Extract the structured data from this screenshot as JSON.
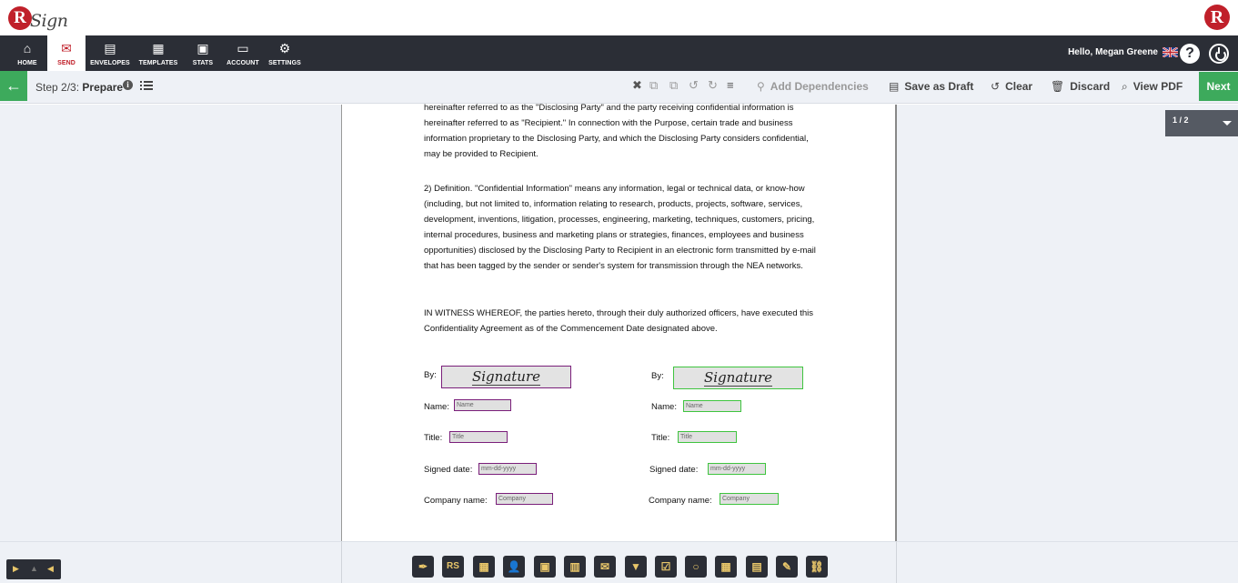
{
  "brand": {
    "logo_letter": "R",
    "logo_text": "Sign",
    "logo_right_letter": "R"
  },
  "nav": {
    "items": [
      {
        "label": "HOME",
        "icon": "home-icon",
        "glyph": "⌂"
      },
      {
        "label": "SEND",
        "icon": "envelope-icon",
        "glyph": "✉"
      },
      {
        "label": "ENVELOPES",
        "icon": "inbox-icon",
        "glyph": "▤"
      },
      {
        "label": "TEMPLATES",
        "icon": "template-icon",
        "glyph": "▦"
      },
      {
        "label": "STATS",
        "icon": "briefcase-icon",
        "glyph": "▣"
      },
      {
        "label": "ACCOUNT",
        "icon": "account-icon",
        "glyph": "▭"
      },
      {
        "label": "SETTINGS",
        "icon": "gear-icon",
        "glyph": "⚙"
      }
    ],
    "active": "SEND",
    "greeting": "Hello, Megan Greene",
    "help_glyph": "?"
  },
  "toolbar": {
    "step_prefix": "Step 2/3:",
    "step_name": "Prepare",
    "info_glyph": "i",
    "tools": [
      {
        "icon": "close-icon",
        "glyph": "✖"
      },
      {
        "icon": "copy-icon",
        "glyph": "⧉"
      },
      {
        "icon": "paste-icon",
        "glyph": "⧉"
      },
      {
        "icon": "undo-icon",
        "glyph": "↺"
      },
      {
        "icon": "redo-icon",
        "glyph": "↻"
      },
      {
        "icon": "align-icon",
        "glyph": "≡"
      }
    ],
    "actions": {
      "add_dependencies": "Add Dependencies",
      "save_draft": "Save as Draft",
      "clear": "Clear",
      "discard": "Discard",
      "view_pdf": "View PDF"
    },
    "next": "Next",
    "back_glyph": "←"
  },
  "document": {
    "para1": "hereinafter referred to as the \"Disclosing Party\" and the party receiving confidential information is hereinafter referred to as \"Recipient.\"  In connection with the Purpose, certain trade and business information proprietary to the Disclosing Party, and which the Disclosing Party considers confidential, may be provided to Recipient.",
    "para2": "2) Definition.  \"Confidential Information\" means any information, legal or technical data, or know-how (including, but not limited to, information relating to research, products, projects, software, services, development, inventions, litigation, processes, engineering, marketing, techniques, customers, pricing, internal procedures, business and marketing plans or strategies, finances, employees and business opportunities) disclosed by the Disclosing Party to Recipient in an electronic form transmitted by e-mail that has been tagged by the sender or sender's system for transmission through the NEA networks.",
    "para3": "IN WITNESS WHEREOF, the parties hereto, through their duly authorized officers, have executed this Confidentiality Agreement as of the Commencement Date designated above.",
    "labels": {
      "by": "By:",
      "name": "Name:",
      "title": "Title:",
      "signed_date": "Signed date:",
      "company_name": "Company name:"
    },
    "fields": {
      "signature": "Signature",
      "name": "Name",
      "title": "Title",
      "date": "mm-dd-yyyy",
      "company": "Company"
    }
  },
  "pager": {
    "page": "1 / 2"
  },
  "colors": {
    "green": "#3daa5c",
    "red": "#c0202a",
    "nav_dark": "#2b2e36",
    "signer1": "#7a1f7a",
    "signer2": "#3fc43f"
  },
  "field_palette": [
    {
      "icon": "pen-icon",
      "glyph": "✒"
    },
    {
      "icon": "initials-icon",
      "glyph": "RS"
    },
    {
      "icon": "calendar-stamp-icon",
      "glyph": "▦"
    },
    {
      "icon": "person-icon",
      "glyph": "👤"
    },
    {
      "icon": "briefcase-icon",
      "glyph": "▣"
    },
    {
      "icon": "building-icon",
      "glyph": "▥"
    },
    {
      "icon": "email-icon",
      "glyph": "✉"
    },
    {
      "icon": "dropdown-icon",
      "glyph": "▼"
    },
    {
      "icon": "checkbox-icon",
      "glyph": "☑"
    },
    {
      "icon": "radio-icon",
      "glyph": "○"
    },
    {
      "icon": "date-icon",
      "glyph": "▦"
    },
    {
      "icon": "text-icon",
      "glyph": "▤"
    },
    {
      "icon": "label-icon",
      "glyph": "✎"
    },
    {
      "icon": "link-icon",
      "glyph": "⛓"
    }
  ]
}
